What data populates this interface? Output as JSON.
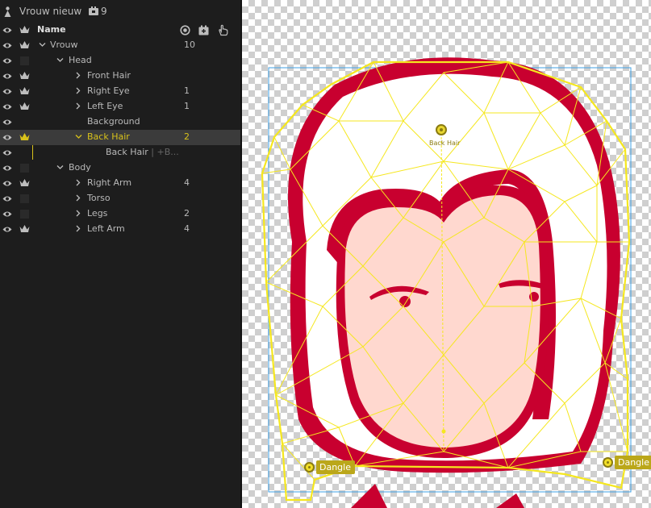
{
  "puppet": {
    "title": "Vrouw nieuw",
    "camera_count": "9"
  },
  "columns": {
    "name": "Name"
  },
  "rows": [
    {
      "label": "Vrouw",
      "num": "10",
      "expander": "open"
    },
    {
      "label": "Head",
      "num": "",
      "expander": "open"
    },
    {
      "label": "Front Hair",
      "num": "",
      "expander": "closed"
    },
    {
      "label": "Right Eye",
      "num": "1",
      "expander": "closed"
    },
    {
      "label": "Left Eye",
      "num": "1",
      "expander": "closed"
    },
    {
      "label": "Background",
      "num": "",
      "expander": "none"
    },
    {
      "label": "Back Hair",
      "num": "2",
      "expander": "open",
      "selected": true
    },
    {
      "label": "Back Hair",
      "suffix": "+B...",
      "num": "",
      "expander": "none"
    },
    {
      "label": "Body",
      "num": "",
      "expander": "open"
    },
    {
      "label": "Right Arm",
      "num": "4",
      "expander": "closed"
    },
    {
      "label": "Torso",
      "num": "",
      "expander": "closed"
    },
    {
      "label": "Legs",
      "num": "2",
      "expander": "closed"
    },
    {
      "label": "Left Arm",
      "num": "4",
      "expander": "closed"
    }
  ],
  "canvas": {
    "origin_handle_label": "Back Hair",
    "dangle_left_label": "Dangle",
    "dangle_right_label": "Dangle",
    "mesh_color": "#f5e71f",
    "hair_red": "#c8002f",
    "skin": "#ffd8cf",
    "selection_color": "#f2df28"
  }
}
